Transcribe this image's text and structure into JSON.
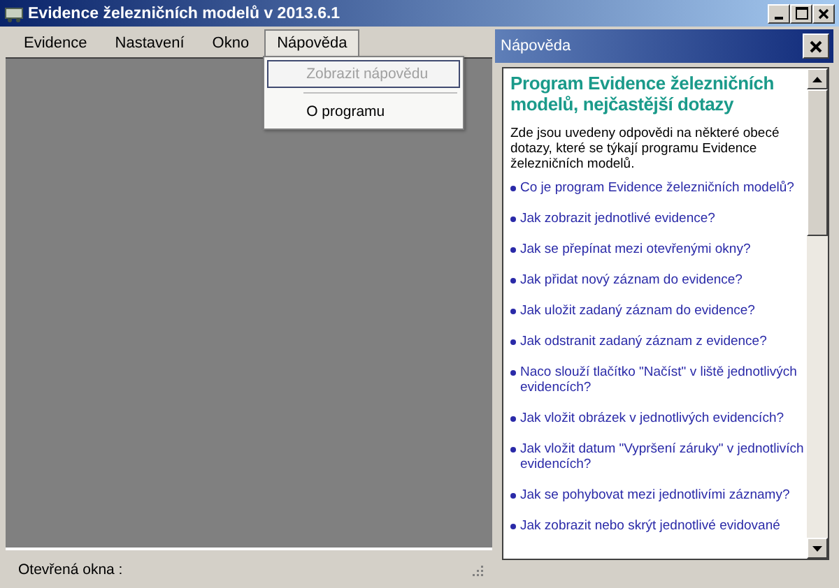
{
  "window": {
    "title": "Evidence železničních modelů v 2013.6.1"
  },
  "menu": [
    {
      "label": "Evidence",
      "selected": false
    },
    {
      "label": "Nastavení",
      "selected": false
    },
    {
      "label": "Okno",
      "selected": false
    },
    {
      "label": "Nápověda",
      "selected": true,
      "dropdown": [
        {
          "kind": "item",
          "label": "Zobrazit nápovědu",
          "disabled": true,
          "selected": true
        },
        {
          "kind": "separator"
        },
        {
          "kind": "item",
          "label": "O programu",
          "disabled": false,
          "selected": false
        }
      ]
    }
  ],
  "help_panel": {
    "title": "Nápověda",
    "heading": "Program Evidence železničních modelů, nejčastější dotazy",
    "intro": "Zde jsou uvedeny odpovědi na některé obecé dotazy, které se týkají programu Evidence železničních modelů.",
    "questions": [
      "Co je program Evidence železničních modelů?",
      "Jak zobrazit jednotlivé evidence?",
      "Jak se přepínat mezi otevřenými okny?",
      "Jak přidat nový záznam do evidence?",
      "Jak uložit zadaný záznam do evidence?",
      "Jak odstranit zadaný záznam z evidence?",
      "Naco slouží tlačítko \"Načíst\" v liště jednotlivých evidencích?",
      "Jak vložit obrázek v jednotlivých evidencích?",
      "Jak vložit datum \"Vypršení záruky\" v jednotlivích evidencích?",
      "Jak se pohybovat mezi jednotlivími záznamy?",
      "Jak zobrazit nebo skrýt jednotlivé evidované"
    ]
  },
  "status_bar": {
    "label": "Otevřená okna :"
  }
}
